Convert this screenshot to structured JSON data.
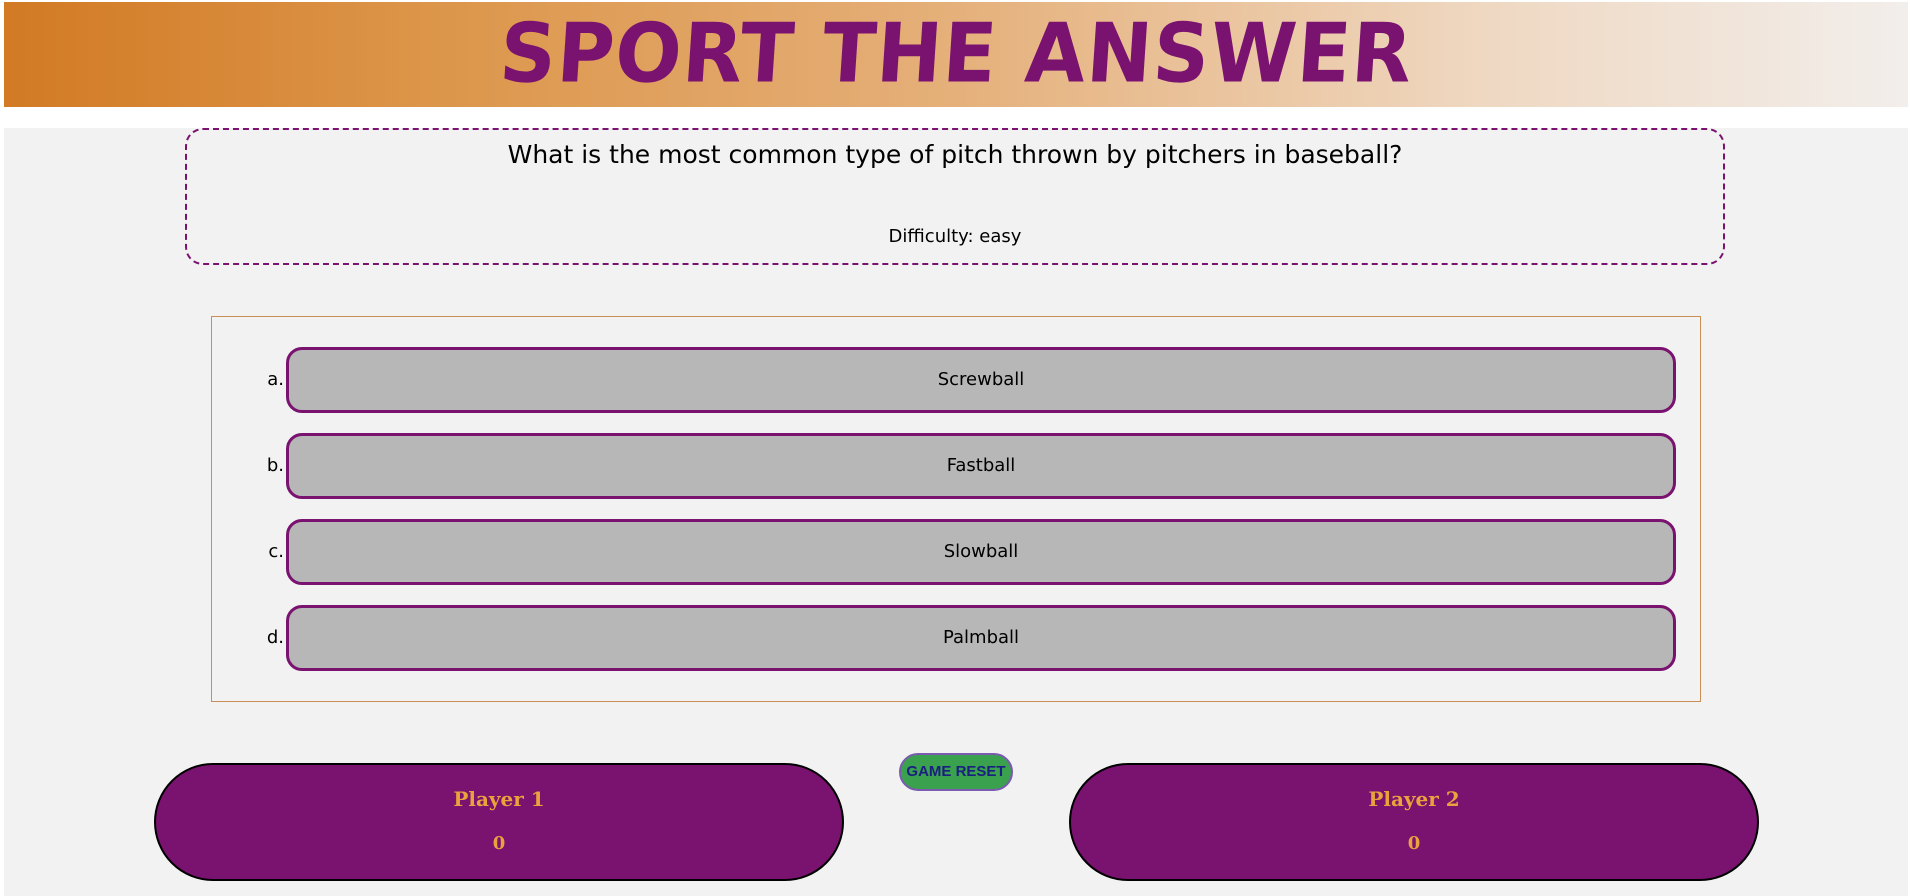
{
  "header": {
    "title": "SPORT THE ANSWER"
  },
  "question": {
    "text": "What is the most common type of pitch thrown by pitchers in baseball?",
    "difficulty": "Difficulty: easy"
  },
  "answers": [
    {
      "letter": "a.",
      "label": "Screwball"
    },
    {
      "letter": "b.",
      "label": "Fastball"
    },
    {
      "letter": "c.",
      "label": "Slowball"
    },
    {
      "letter": "d.",
      "label": "Palmball"
    }
  ],
  "controls": {
    "reset_label": "GAME RESET"
  },
  "players": [
    {
      "name": "Player 1",
      "score": "0"
    },
    {
      "name": "Player 2",
      "score": "0"
    }
  ],
  "colors": {
    "accent_purple": "#7a1270",
    "header_orange": "#d27a24",
    "score_gold": "#e8a33d",
    "answer_gray": "#b7b7b7",
    "reset_green": "#3aa14e"
  }
}
